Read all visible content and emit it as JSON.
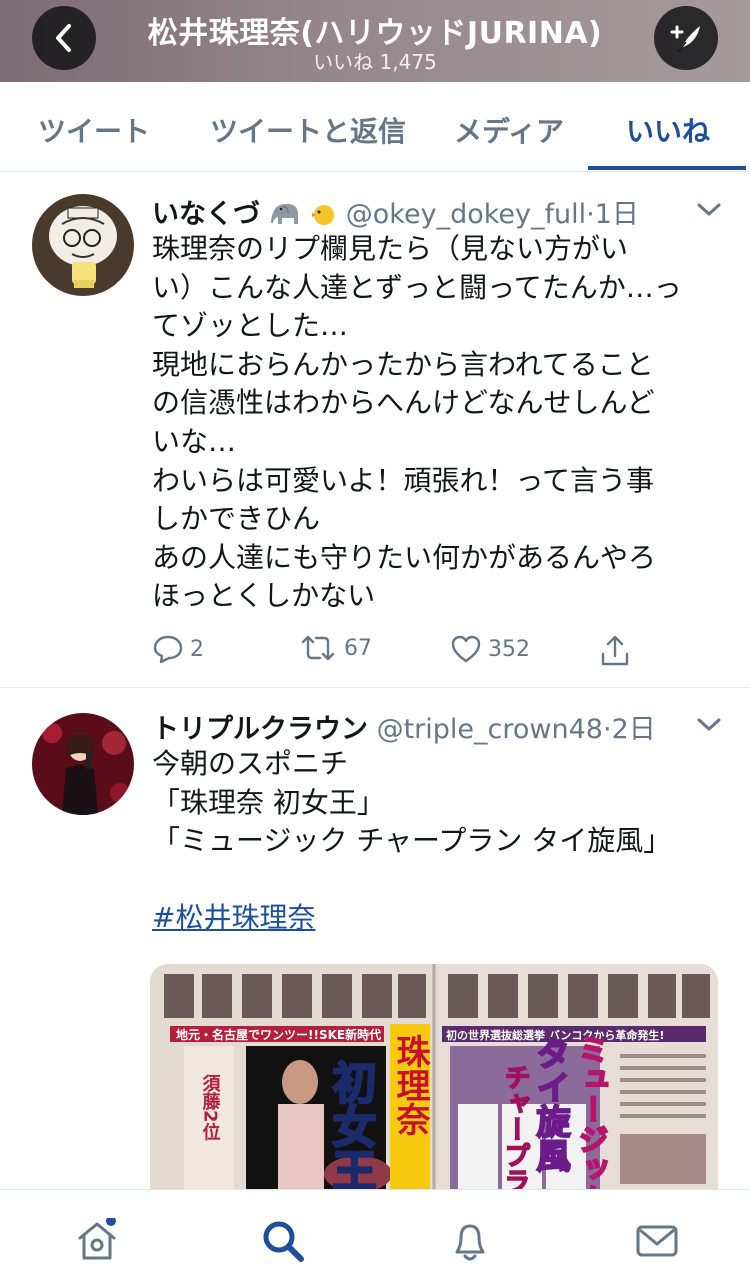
{
  "header": {
    "title": "松井珠理奈(ハリウッドJURINA)",
    "subtitle": "いいね 1,475",
    "back_icon": "chevron-left-icon",
    "compose_icon": "feather-plus-icon"
  },
  "tabs": [
    {
      "label": "ツイート",
      "active": false
    },
    {
      "label": "ツイートと返信",
      "active": false
    },
    {
      "label": "メディア",
      "active": false
    },
    {
      "label": "いいね",
      "active": true
    }
  ],
  "tweets": [
    {
      "name": "いなくづ",
      "name_emoji": [
        "elephant-icon",
        "chick-icon"
      ],
      "handle": "@okey_dokey_full",
      "time": "1日",
      "lines": [
        "珠理奈のリプ欄見たら（見ない方がい",
        "い）こんな人達とずっと闘ってたんか…っ",
        "てゾッとした…",
        "現地におらんかったから言われてること",
        "の信憑性はわからへんけどなんせしんど",
        "いな…",
        "わいらは可愛いよ！頑張れ！って言う事",
        "しかできひん",
        "あの人達にも守りたい何かがあるんやろ",
        "ほっとくしかない"
      ],
      "replies": "2",
      "retweets": "67",
      "likes": "352"
    },
    {
      "name": "トリプルクラウン",
      "handle": "@triple_crown48",
      "time": "2日",
      "lines": [
        "今朝のスポニチ",
        "「珠理奈 初女王」",
        "「ミュージック チャープラン タイ旋風」"
      ],
      "hashtag": "#松井珠理奈",
      "image": {
        "left_page": {
          "banner": "地元・名古屋でワンツー!!SKE新時代",
          "headline1": "珠理奈",
          "headline2": "初女王",
          "sub": "須藤2位"
        },
        "right_page": {
          "banner": "初の世界選抜総選挙 バンコクから革命発生!",
          "headline1": "ミュージック",
          "headline2": "タイ旋風",
          "headline3": "チャープラン"
        }
      }
    }
  ],
  "bottom_nav": [
    "home-icon",
    "search-icon",
    "notifications-bell-icon",
    "messages-envelope-icon"
  ],
  "colors": {
    "accent": "#1d4f9c",
    "muted": "#657786",
    "border": "#e1e8ed",
    "notify_dot": "#1d4f9c"
  }
}
